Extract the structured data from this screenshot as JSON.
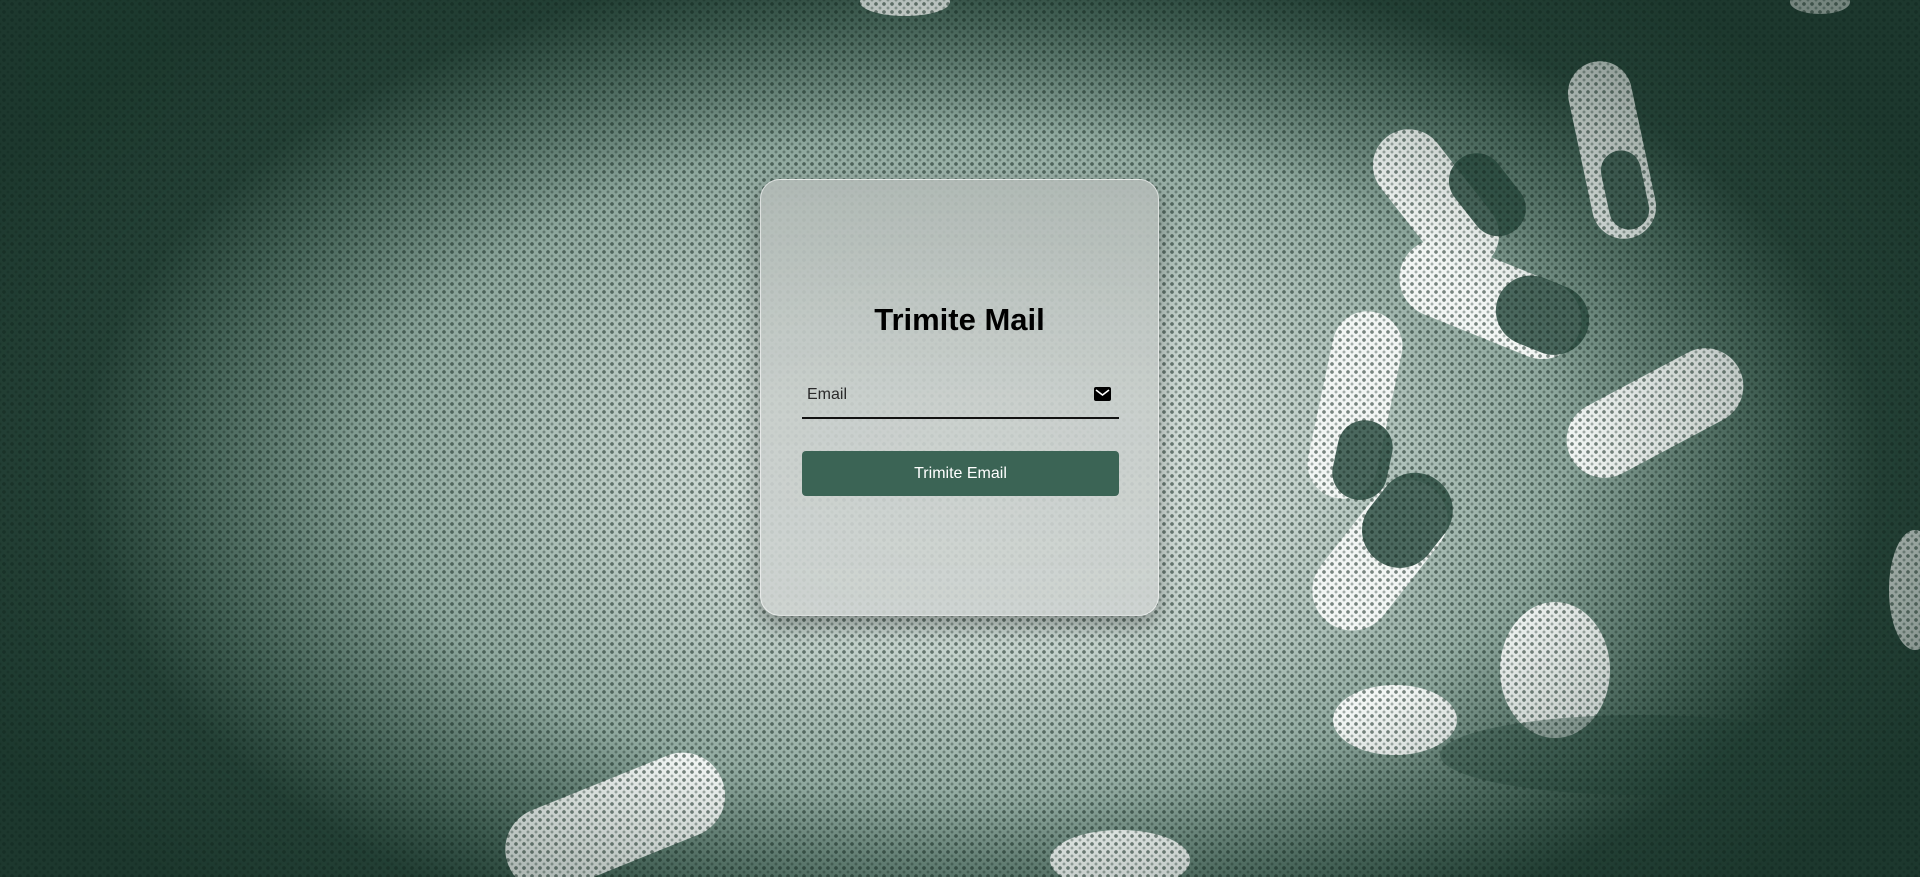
{
  "page": {
    "title": "Trimite Mail"
  },
  "form": {
    "email_placeholder": "Email",
    "email_value": "",
    "submit_label": "Trimite Email"
  },
  "icons": {
    "email": "envelope-icon"
  },
  "colors": {
    "button": "#3b6455",
    "background_tint": "#2f4d42"
  }
}
